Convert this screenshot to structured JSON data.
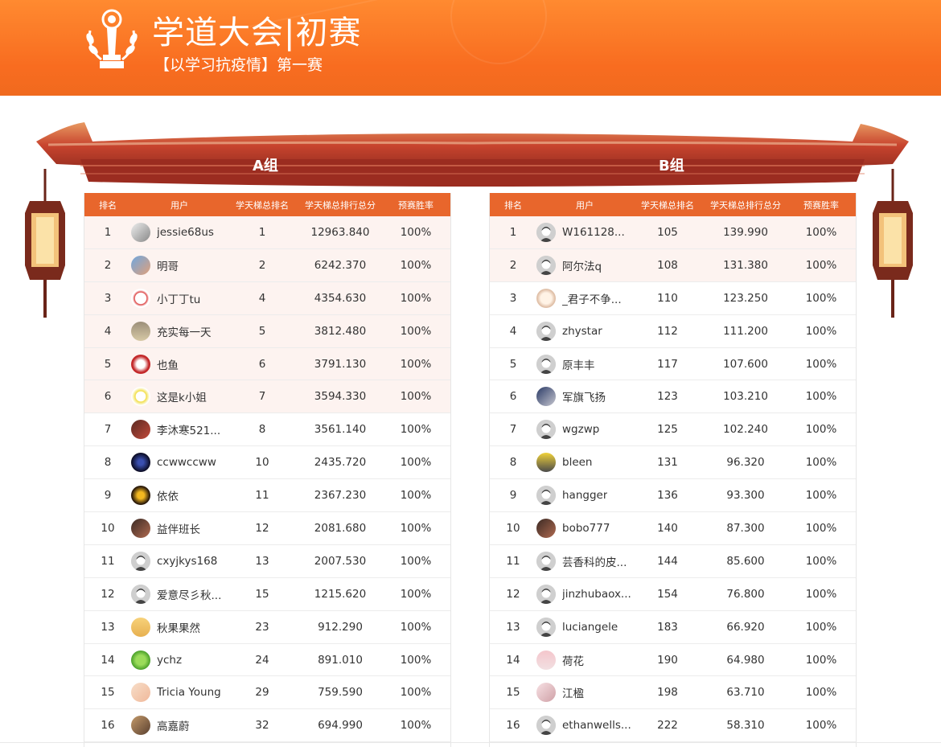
{
  "header": {
    "title": "学道大会|初赛",
    "subtitle": "【以学习抗疫情】第一赛"
  },
  "colors": {
    "banner": "#f86c20",
    "table_header": "#e8662c",
    "top_row_bg": "#fdf3f0"
  },
  "columns": {
    "rank": "排名",
    "user": "用户",
    "tianti_rank": "学天梯总排名",
    "tianti_score": "学天梯总排行总分",
    "win_rate": "预赛胜率"
  },
  "group_a": {
    "label": "A组",
    "rows": [
      {
        "rank": "1",
        "name": "jessie68us",
        "tianti": "1",
        "score": "12963.840",
        "win": "100%",
        "avatar": "photo-grey-icon"
      },
      {
        "rank": "2",
        "name": "明哥",
        "tianti": "2",
        "score": "6242.370",
        "win": "100%",
        "avatar": "photo-blue-icon"
      },
      {
        "rank": "3",
        "name": "小丁丁tu",
        "tianti": "4",
        "score": "4354.630",
        "win": "100%",
        "avatar": "photo-white-icon"
      },
      {
        "rank": "4",
        "name": "充实每一天",
        "tianti": "5",
        "score": "3812.480",
        "win": "100%",
        "avatar": "photo-cartoon-icon"
      },
      {
        "rank": "5",
        "name": "也鱼",
        "tianti": "6",
        "score": "3791.130",
        "win": "100%",
        "avatar": "photo-red-icon"
      },
      {
        "rank": "6",
        "name": "这是k小姐",
        "tianti": "7",
        "score": "3594.330",
        "win": "100%",
        "avatar": "sun-icon"
      },
      {
        "rank": "7",
        "name": "李沐寒521...",
        "tianti": "8",
        "score": "3561.140",
        "win": "100%",
        "avatar": "photo-dark-icon"
      },
      {
        "rank": "8",
        "name": "ccwwccww",
        "tianti": "10",
        "score": "2435.720",
        "win": "100%",
        "avatar": "photo-night-icon"
      },
      {
        "rank": "9",
        "name": "依依",
        "tianti": "11",
        "score": "2367.230",
        "win": "100%",
        "avatar": "photo-gold-icon"
      },
      {
        "rank": "10",
        "name": "益伴班长",
        "tianti": "12",
        "score": "2081.680",
        "win": "100%",
        "avatar": "photo-face-icon"
      },
      {
        "rank": "11",
        "name": "cxyjkys168",
        "tianti": "13",
        "score": "2007.530",
        "win": "100%",
        "avatar": "default-avatar-icon"
      },
      {
        "rank": "12",
        "name": "爱意尽彡秋...",
        "tianti": "15",
        "score": "1215.620",
        "win": "100%",
        "avatar": "default-avatar-icon"
      },
      {
        "rank": "13",
        "name": "秋果果然",
        "tianti": "23",
        "score": "912.290",
        "win": "100%",
        "avatar": "photo-yellow-icon"
      },
      {
        "rank": "14",
        "name": "ychz",
        "tianti": "24",
        "score": "891.010",
        "win": "100%",
        "avatar": "leaf-icon"
      },
      {
        "rank": "15",
        "name": "Tricia Young",
        "tianti": "29",
        "score": "759.590",
        "win": "100%",
        "avatar": "photo-light-icon"
      },
      {
        "rank": "16",
        "name": "高嘉蔚",
        "tianti": "32",
        "score": "694.990",
        "win": "100%",
        "avatar": "photo-brown-icon"
      }
    ]
  },
  "group_b": {
    "label": "B组",
    "rows": [
      {
        "rank": "1",
        "name": "W161128...",
        "tianti": "105",
        "score": "139.990",
        "win": "100%",
        "avatar": "default-avatar-icon"
      },
      {
        "rank": "2",
        "name": "阿尔法q",
        "tianti": "108",
        "score": "131.380",
        "win": "100%",
        "avatar": "default-avatar-icon"
      },
      {
        "rank": "3",
        "name": "_君子不争...",
        "tianti": "110",
        "score": "123.250",
        "win": "100%",
        "avatar": "photo-cartoon-girl-icon"
      },
      {
        "rank": "4",
        "name": "zhystar",
        "tianti": "112",
        "score": "111.200",
        "win": "100%",
        "avatar": "default-avatar-icon"
      },
      {
        "rank": "5",
        "name": "原丰丰",
        "tianti": "117",
        "score": "107.600",
        "win": "100%",
        "avatar": "default-avatar-icon"
      },
      {
        "rank": "6",
        "name": "军旗飞扬",
        "tianti": "123",
        "score": "103.210",
        "win": "100%",
        "avatar": "photo-car-icon"
      },
      {
        "rank": "7",
        "name": "wgzwp",
        "tianti": "125",
        "score": "102.240",
        "win": "100%",
        "avatar": "default-avatar-icon"
      },
      {
        "rank": "8",
        "name": "bleen",
        "tianti": "131",
        "score": "96.320",
        "win": "100%",
        "avatar": "photo-bottle-icon"
      },
      {
        "rank": "9",
        "name": "hangger",
        "tianti": "136",
        "score": "93.300",
        "win": "100%",
        "avatar": "default-avatar-icon"
      },
      {
        "rank": "10",
        "name": "bobo777",
        "tianti": "140",
        "score": "87.300",
        "win": "100%",
        "avatar": "photo-face-icon"
      },
      {
        "rank": "11",
        "name": "芸香科的皮...",
        "tianti": "144",
        "score": "85.600",
        "win": "100%",
        "avatar": "default-avatar-icon"
      },
      {
        "rank": "12",
        "name": "jinzhubaox...",
        "tianti": "154",
        "score": "76.800",
        "win": "100%",
        "avatar": "default-avatar-icon"
      },
      {
        "rank": "13",
        "name": "luciangele",
        "tianti": "183",
        "score": "66.920",
        "win": "100%",
        "avatar": "default-avatar-icon"
      },
      {
        "rank": "14",
        "name": "荷花",
        "tianti": "190",
        "score": "64.980",
        "win": "100%",
        "avatar": "photo-pink-icon"
      },
      {
        "rank": "15",
        "name": "江楹",
        "tianti": "198",
        "score": "63.710",
        "win": "100%",
        "avatar": "photo-girl-icon"
      },
      {
        "rank": "16",
        "name": "ethanwells...",
        "tianti": "222",
        "score": "58.310",
        "win": "100%",
        "avatar": "default-avatar-icon"
      }
    ]
  }
}
